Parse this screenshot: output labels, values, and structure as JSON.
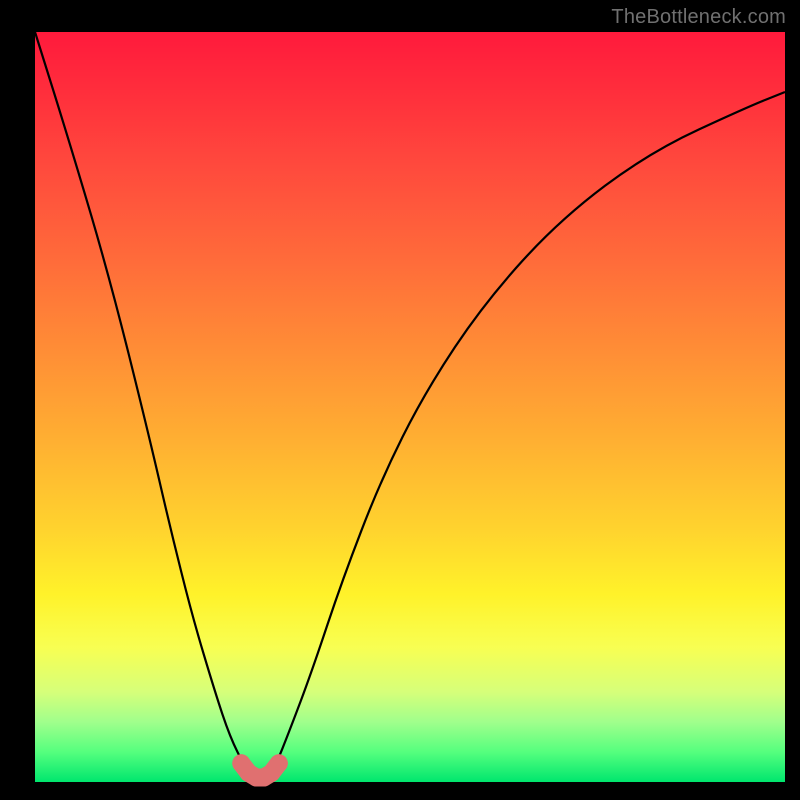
{
  "watermark": "TheBottleneck.com",
  "colors": {
    "frame": "#000000",
    "curve": "#000000",
    "marker": "#e07070",
    "gradient_top": "#ff1a3c",
    "gradient_bottom": "#00e66e"
  },
  "chart_data": {
    "type": "line",
    "title": "",
    "xlabel": "",
    "ylabel": "",
    "xlim": [
      0,
      100
    ],
    "ylim": [
      0,
      100
    ],
    "grid": false,
    "legend": false,
    "annotations": [
      "TheBottleneck.com"
    ],
    "series": [
      {
        "name": "bottleneck-curve",
        "x": [
          0,
          5,
          10,
          15,
          18,
          21,
          24,
          26,
          28,
          29,
          30,
          31,
          32,
          34,
          37,
          41,
          46,
          52,
          60,
          70,
          82,
          95,
          100
        ],
        "y": [
          100,
          84,
          67,
          47,
          34,
          22,
          12,
          6,
          2,
          0.7,
          0.3,
          0.7,
          2,
          7,
          15,
          27,
          40,
          52,
          64,
          75,
          84,
          90,
          92
        ]
      }
    ],
    "markers": {
      "name": "optimum-band",
      "x": [
        27.5,
        28.5,
        29.5,
        30.5,
        31.5,
        32.5
      ],
      "y": [
        2.5,
        1.2,
        0.6,
        0.6,
        1.2,
        2.5
      ]
    }
  }
}
